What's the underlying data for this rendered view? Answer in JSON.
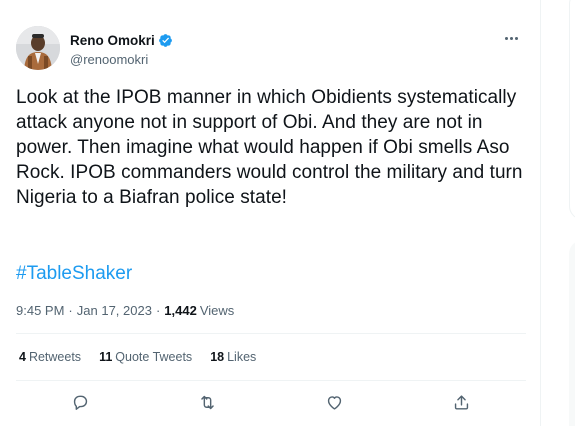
{
  "author": {
    "display_name": "Reno Omokri",
    "handle": "@renoomokri"
  },
  "tweet": {
    "text": "Look at the IPOB manner in which Obidients systematically attack anyone not in support of Obi. And they are not in power. Then imagine what would happen if Obi smells Aso Rock. IPOB commanders would control the military and turn Nigeria to a Biafran police state!",
    "hashtag": "#TableShaker",
    "time": "9:45 PM",
    "separator": "·",
    "date": "Jan 17, 2023",
    "views_count": "1,442",
    "views_label": "Views"
  },
  "stats": {
    "retweets_count": "4",
    "retweets_label": "Retweets",
    "quotes_count": "11",
    "quotes_label": "Quote Tweets",
    "likes_count": "18",
    "likes_label": "Likes"
  },
  "icons": {
    "verified": "verified-badge-icon",
    "more": "more-icon",
    "reply": "reply-icon",
    "retweet": "retweet-icon",
    "like": "like-icon",
    "share": "share-icon"
  },
  "colors": {
    "accent": "#1d9bf0",
    "text_primary": "#0f1419",
    "text_secondary": "#536471",
    "border": "#eff3f4"
  }
}
